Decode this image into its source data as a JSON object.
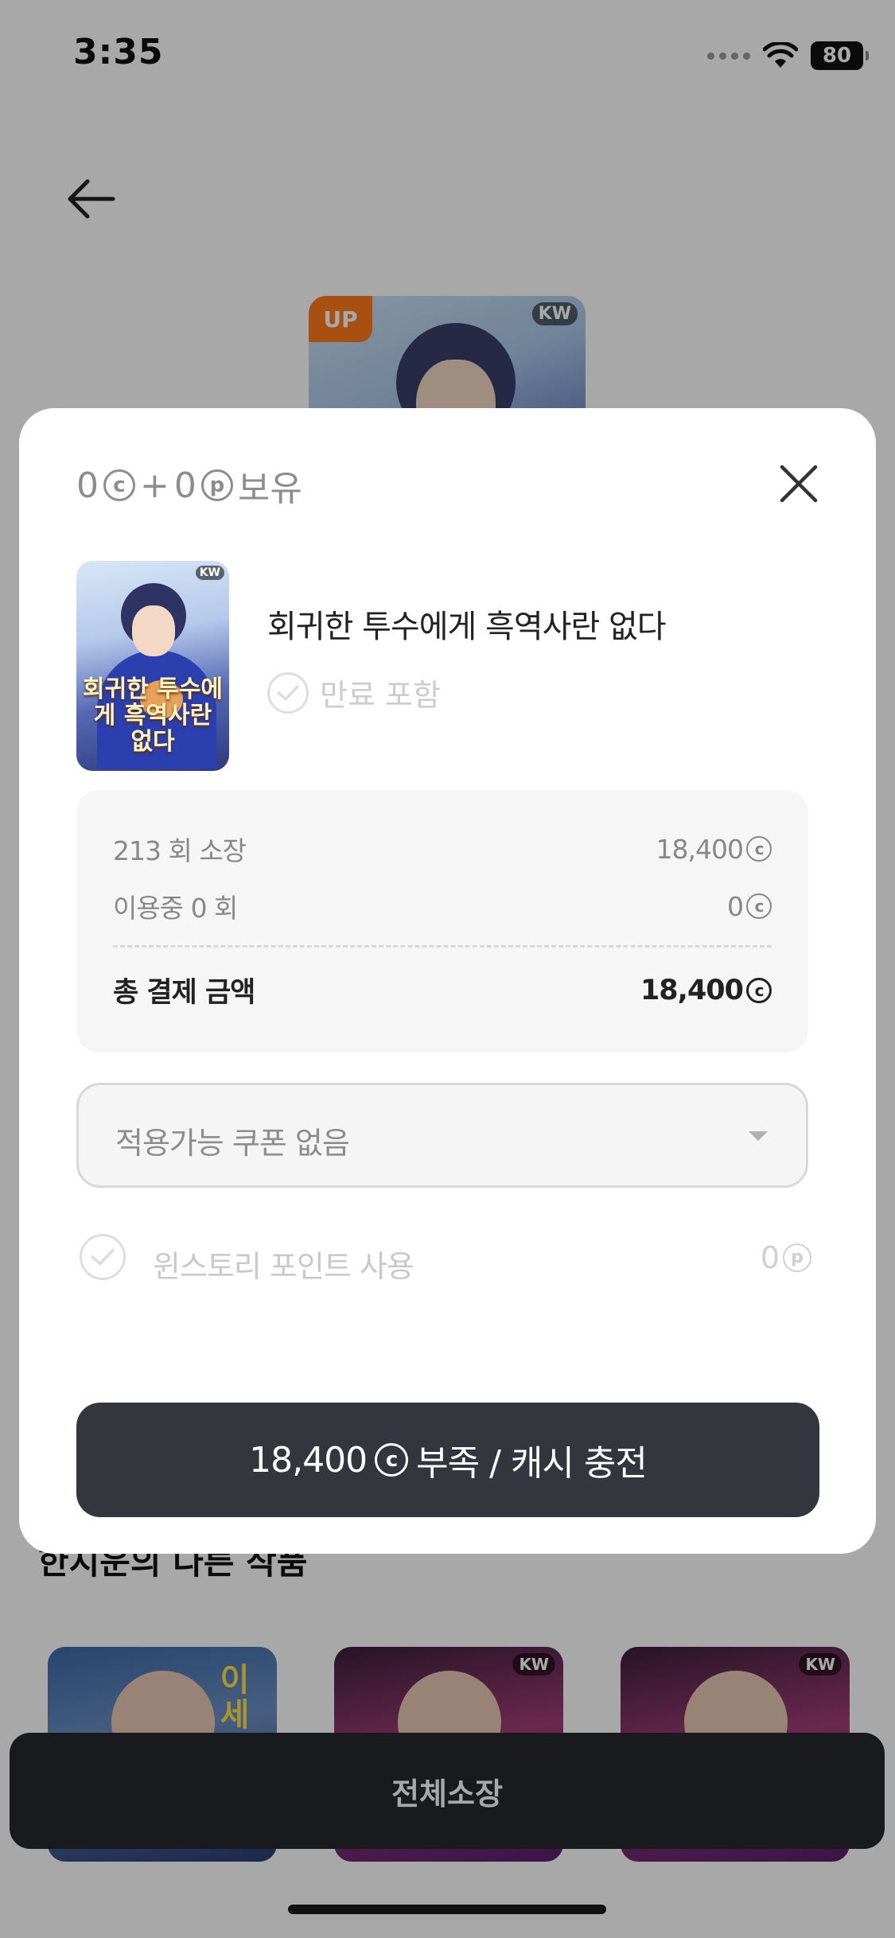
{
  "status_bar": {
    "time": "3:35",
    "battery": "80"
  },
  "background": {
    "top_cover_badge": "UP",
    "top_cover_publisher": "KW",
    "section_title": "한지운의 다른 작품",
    "related_first_title": "이세상톱",
    "related_publisher": "KW",
    "full_purchase_label": "전체소장"
  },
  "sheet": {
    "balance": {
      "cash": "0",
      "plus": "+",
      "points": "0",
      "suffix": "보유",
      "cash_symbol": "c",
      "point_symbol": "p"
    },
    "work": {
      "title": "회귀한 투수에게 흑역사란 없다",
      "cover_title": "회귀한 투수에게 흑역사란 없다",
      "cover_publisher": "KW",
      "free_included_label": "만료 포함"
    },
    "summary": {
      "owned_label": "213 회 소장",
      "owned_amount": "18,400",
      "in_use_label": "이용중 0 회",
      "in_use_amount": "0",
      "total_label": "총 결제 금액",
      "total_amount": "18,400"
    },
    "coupon": {
      "selected": "적용가능 쿠폰 없음"
    },
    "points_usage": {
      "label": "윈스토리 포인트 사용",
      "amount": "0"
    },
    "charge_button": {
      "amount": "18,400",
      "label": "부족 / 캐시 충전"
    }
  },
  "colors": {
    "overlay": "#000000",
    "button_dark": "#34363e",
    "up_badge": "#ff7a1a"
  }
}
